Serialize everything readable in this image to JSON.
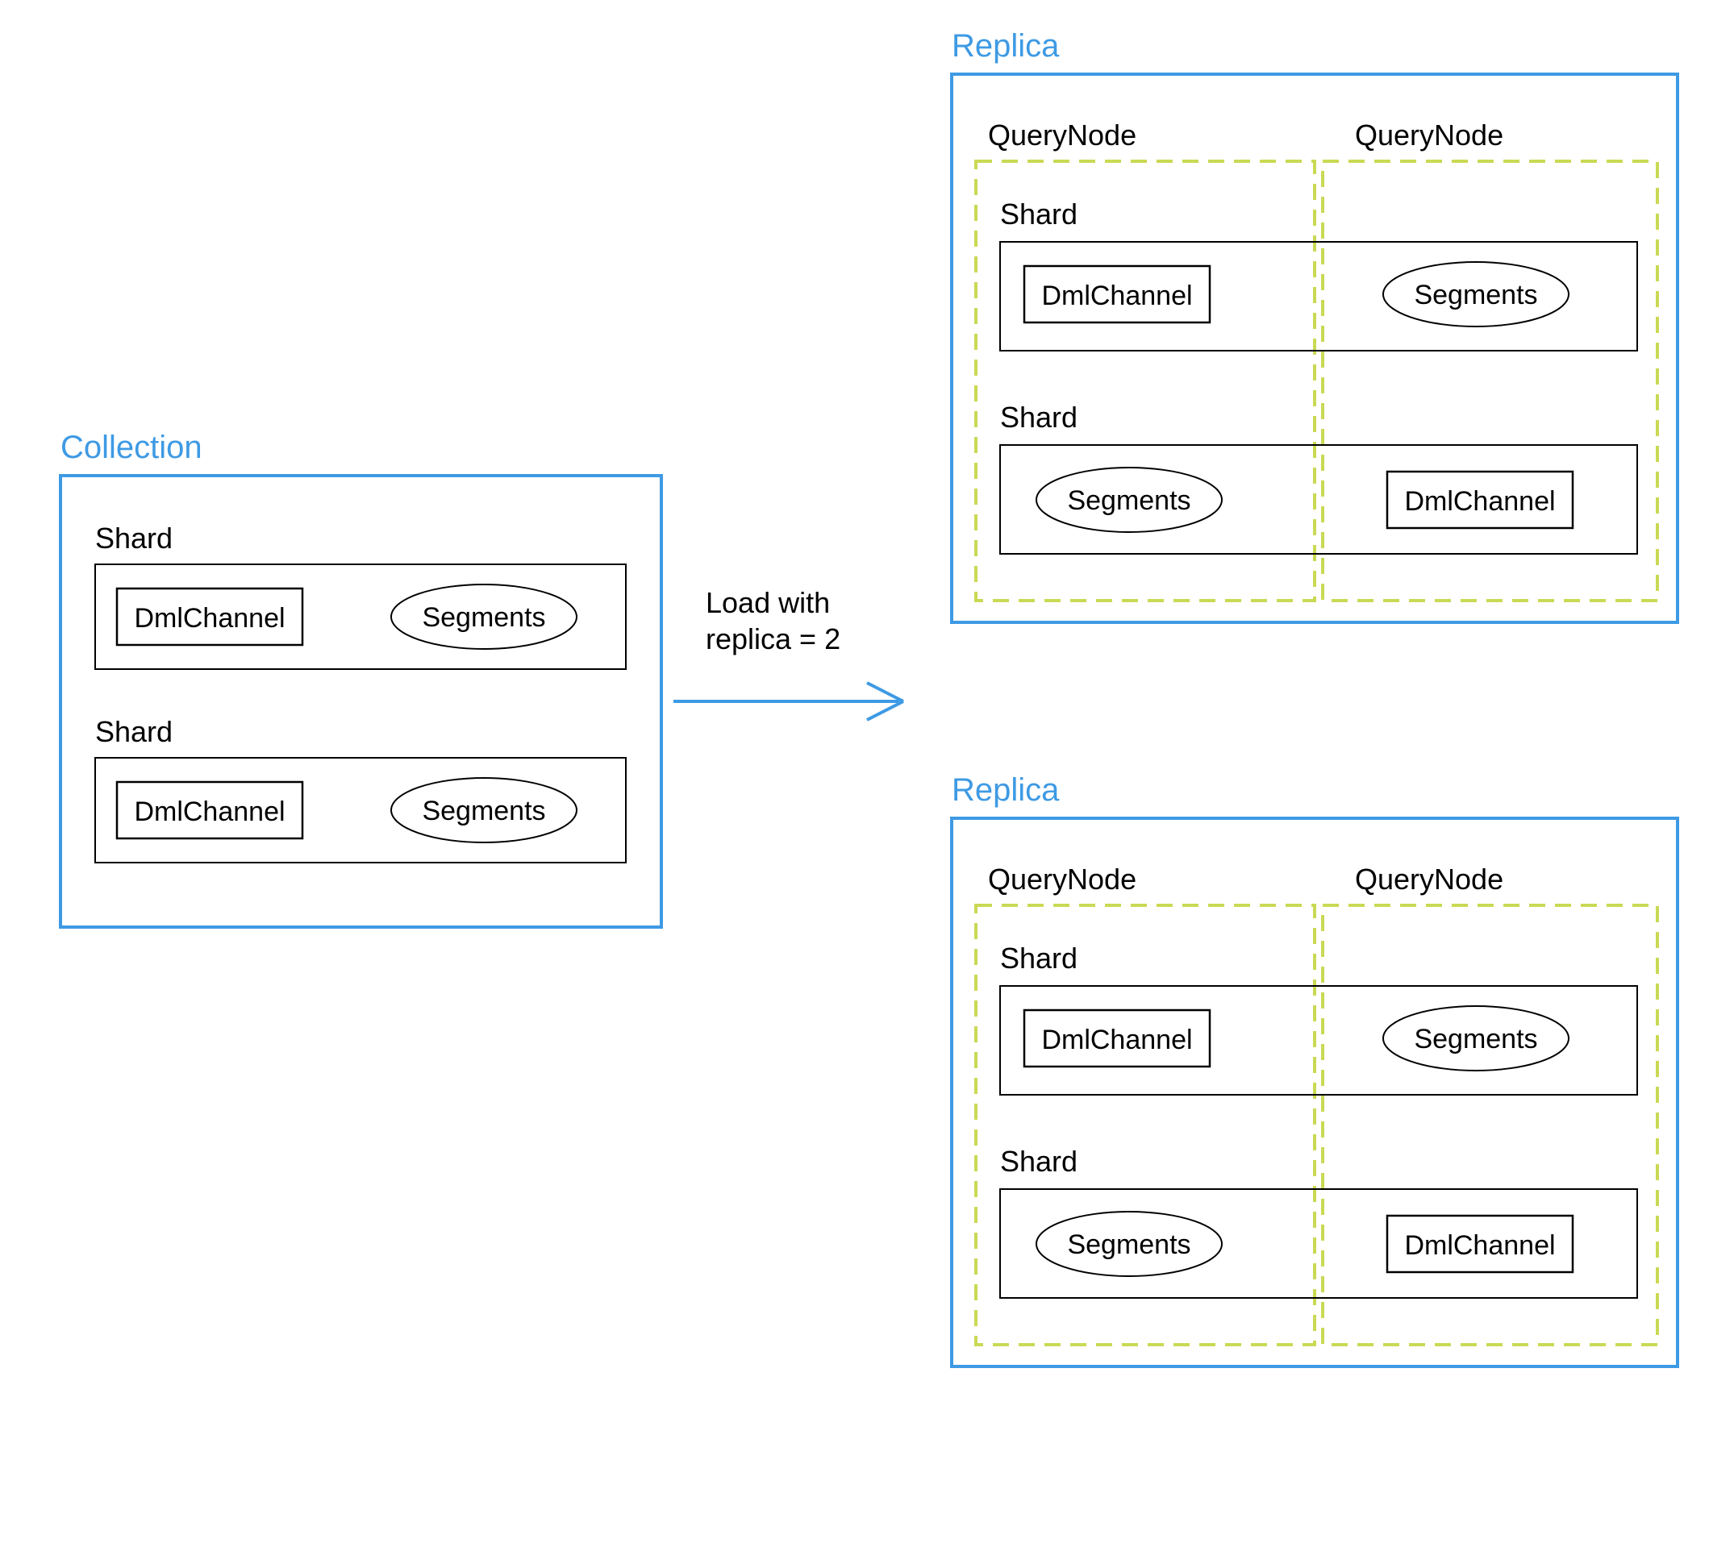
{
  "collection": {
    "title": "Collection",
    "shard1_label": "Shard",
    "shard1_dml": "DmlChannel",
    "shard1_seg": "Segments",
    "shard2_label": "Shard",
    "shard2_dml": "DmlChannel",
    "shard2_seg": "Segments"
  },
  "arrow": {
    "line1": "Load with",
    "line2": "replica = 2"
  },
  "replica1": {
    "title": "Replica",
    "qn1": "QueryNode",
    "qn2": "QueryNode",
    "shard1_label": "Shard",
    "shard1_dml": "DmlChannel",
    "shard1_seg": "Segments",
    "shard2_label": "Shard",
    "shard2_seg": "Segments",
    "shard2_dml": "DmlChannel"
  },
  "replica2": {
    "title": "Replica",
    "qn1": "QueryNode",
    "qn2": "QueryNode",
    "shard1_label": "Shard",
    "shard1_dml": "DmlChannel",
    "shard1_seg": "Segments",
    "shard2_label": "Shard",
    "shard2_seg": "Segments",
    "shard2_dml": "DmlChannel"
  }
}
